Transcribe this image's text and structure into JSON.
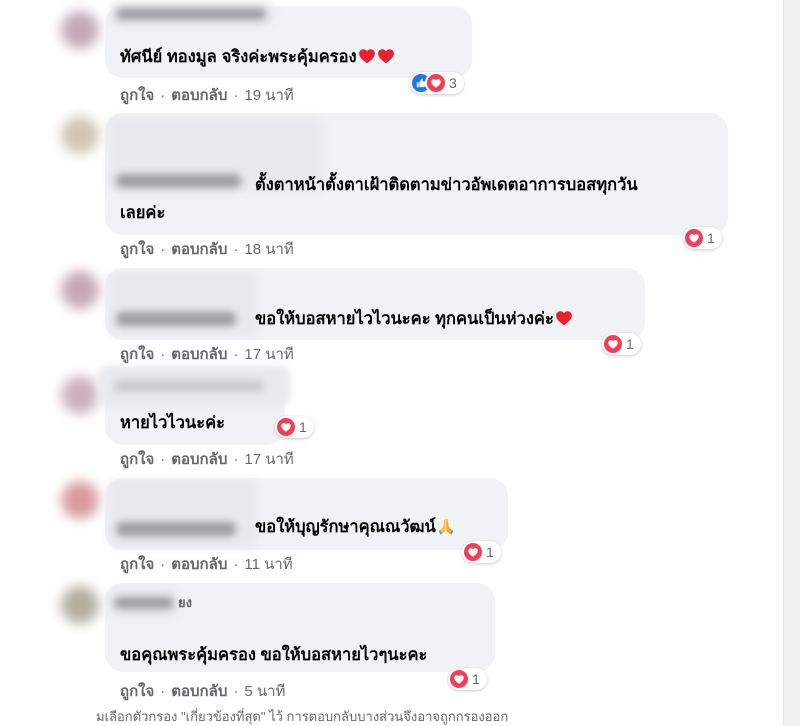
{
  "colors": {
    "page_background": "#ffffff",
    "bubble": "#f0f2f5",
    "text": "#050505",
    "meta_text": "#65676b",
    "like_blue": "#1877f2",
    "love_red": "#f33e58",
    "heart_emoji": "#e8202f",
    "scrollbar_track": "#f1f1f1"
  },
  "action_labels": {
    "like": "ถูกใจ",
    "reply": "ตอบกลับ",
    "separator": "·"
  },
  "comments": [
    {
      "tagged_name": "ทัศนีย์ ทองมูล",
      "text_lines": [
        "จริงค่ะพระคุ้มครอง"
      ],
      "trailing_emojis": [
        "red-heart",
        "red-heart"
      ],
      "reactions": {
        "types": [
          "like",
          "love"
        ],
        "count": "3"
      },
      "time": "19 นาที"
    },
    {
      "text_lines": [
        "ตั้งตาหน้าตั้งตาเฝ้าติดตามข่าวอัพเดตอาการบอสทุกวัน",
        "เลยค่ะ"
      ],
      "reactions": {
        "types": [
          "love"
        ],
        "count": "1"
      },
      "time": "18 นาที"
    },
    {
      "text_lines": [
        "ขอให้บอสหายไวไวนะคะ ทุกคนเป็นห่วงค่ะ"
      ],
      "trailing_emojis": [
        "red-heart"
      ],
      "reactions": {
        "types": [
          "love"
        ],
        "count": "1"
      },
      "time": "17 นาที"
    },
    {
      "text_lines": [
        "หายไวไวนะค่ะ"
      ],
      "reactions": {
        "types": [
          "love"
        ],
        "count": "1"
      },
      "time": "17 นาที"
    },
    {
      "text_lines": [
        "ขอให้บุญรักษาคุณณวัฒน์"
      ],
      "trailing_emojis": [
        "folded-hands"
      ],
      "reactions": {
        "types": [
          "love"
        ],
        "count": "1"
      },
      "time": "11 นาที"
    },
    {
      "author_visible_fragment": "ยง",
      "text_lines": [
        "ขอคุณพระคุ้มครอง ขอให้บอสหายไวๆนะคะ"
      ],
      "reactions": {
        "types": [
          "love"
        ],
        "count": "1"
      },
      "time": "5 นาที"
    }
  ],
  "filter_notice": "มเลือกตัวกรอง \"เกี่ยวข้องที่สุด\" ไว้ การตอบกลับบางส่วนจึงอาจถูกกรองออก"
}
